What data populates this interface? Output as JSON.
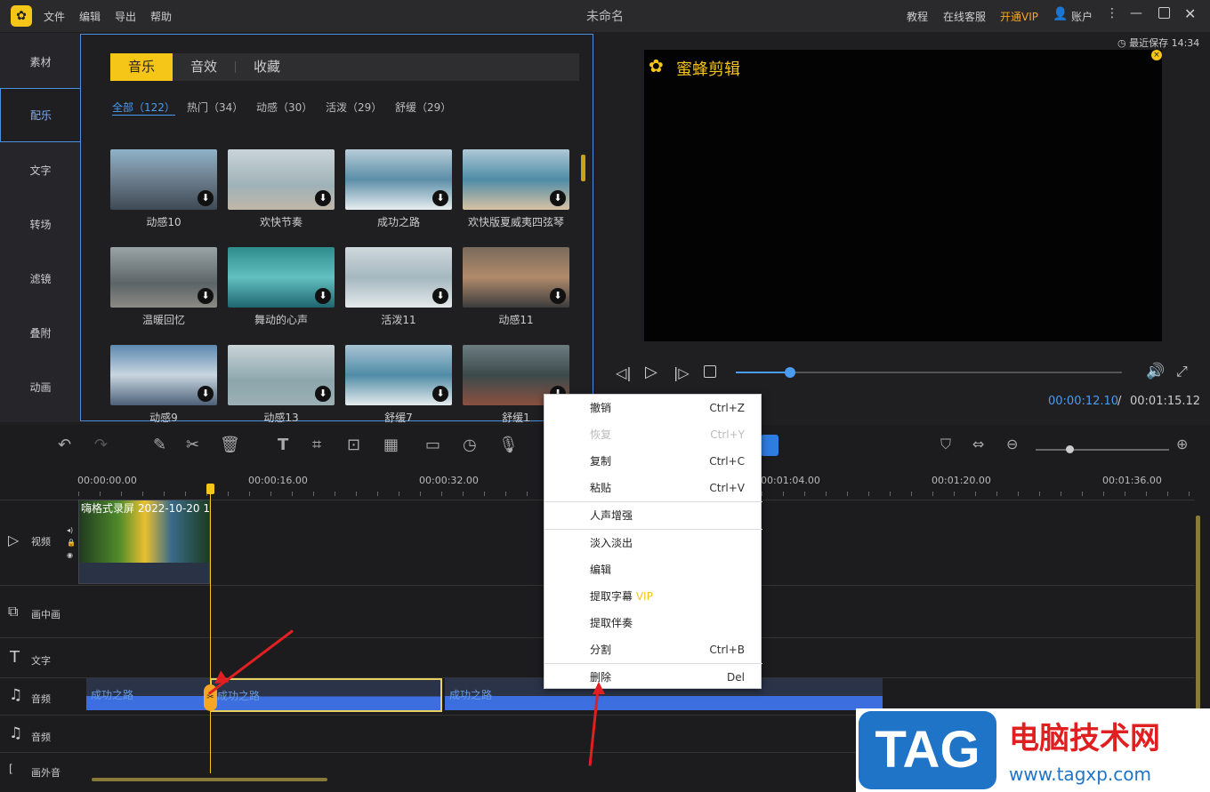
{
  "app": {
    "title": "未命名",
    "menu": [
      "文件",
      "编辑",
      "导出",
      "帮助"
    ],
    "right": [
      "教程",
      "在线客服",
      "开通VIP",
      "账户"
    ],
    "saved": "最近保存 14:34"
  },
  "nav": [
    "素材",
    "配乐",
    "文字",
    "转场",
    "滤镜",
    "叠附",
    "动画"
  ],
  "library": {
    "tabs": [
      "音乐",
      "音效",
      "收藏"
    ],
    "categories": [
      "全部（122）",
      "热门（34）",
      "动感（30）",
      "活泼（29）",
      "舒缓（29）"
    ],
    "items": [
      "动感10",
      "欢快节奏",
      "成功之路",
      "欢快版夏威夷四弦琴",
      "温暖回忆",
      "舞动的心声",
      "活泼11",
      "动感11",
      "动感9",
      "动感13",
      "舒缓7",
      "舒缓1"
    ]
  },
  "preview": {
    "brand": "蜜蜂剪辑",
    "current": "00:00:12.10",
    "sep": "/",
    "total": "00:01:15.12",
    "progress": 0.14
  },
  "timeline": {
    "ticks": [
      "00:00:00.00",
      "00:00:16.00",
      "00:00:32.00",
      "00:01:04.00",
      "00:01:20.00",
      "00:01:36.00"
    ],
    "tracks": [
      "视频",
      "画中画",
      "文字",
      "音频",
      "音频",
      "画外音"
    ],
    "video_clip": "嗨格式录屏 2022-10-20 1",
    "audio_clips": [
      "成功之路",
      "成功之路",
      "成功之路"
    ]
  },
  "context_menu": [
    {
      "label": "撤销",
      "shortcut": "Ctrl+Z"
    },
    {
      "label": "恢复",
      "shortcut": "Ctrl+Y",
      "disabled": true
    },
    {
      "label": "复制",
      "shortcut": "Ctrl+C"
    },
    {
      "label": "粘贴",
      "shortcut": "Ctrl+V"
    },
    {
      "label": "人声增强",
      "shortcut": ""
    },
    {
      "label": "淡入淡出",
      "shortcut": ""
    },
    {
      "label": "编辑",
      "shortcut": ""
    },
    {
      "label": "提取字幕",
      "badge": "VIP",
      "shortcut": ""
    },
    {
      "label": "提取伴奏",
      "shortcut": ""
    },
    {
      "label": "分割",
      "shortcut": "Ctrl+B"
    },
    {
      "label": "删除",
      "shortcut": "Del"
    }
  ],
  "watermark": {
    "tag": "TAG",
    "title": "电脑技术网",
    "url": "www.tagxp.com"
  },
  "colors": {
    "accent": "#f5c518",
    "blue": "#4a9cf0"
  }
}
